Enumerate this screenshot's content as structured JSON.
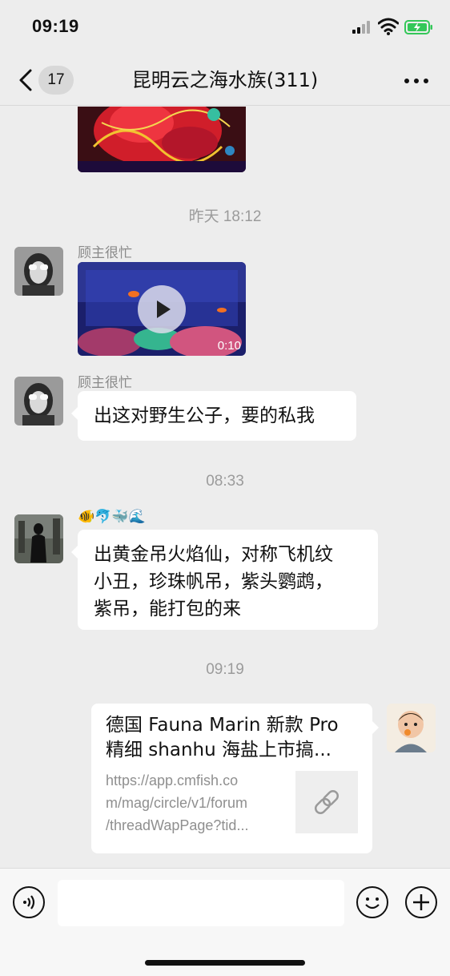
{
  "status_bar": {
    "time": "09:19"
  },
  "nav": {
    "unread_count": "17",
    "title": "昆明云之海水族(311)"
  },
  "messages": [
    {
      "type": "timestamp",
      "text": "昨天 18:12"
    },
    {
      "type": "video",
      "sender": "顾主很忙",
      "duration": "0:10"
    },
    {
      "type": "text",
      "sender": "顾主很忙",
      "text": "出这对野生公子，要的私我"
    },
    {
      "type": "timestamp",
      "text": "08:33"
    },
    {
      "type": "text",
      "sender_emoji": "🐠🐬🐳🌊",
      "lines": [
        "出黄金吊火焰仙，对称飞机纹",
        "小丑，珍珠帆吊，紫头鹦鹉，",
        "紫吊，能打包的来"
      ]
    },
    {
      "type": "timestamp",
      "text": "09:19"
    },
    {
      "type": "link",
      "title_lines": [
        "德国 Fauna Marin 新款 Pro",
        "精细 shanhu 海盐上市搞..."
      ],
      "url_lines": [
        "https://app.cmfish.co",
        "m/mag/circle/v1/forum",
        "/threadWapPage?tid..."
      ]
    }
  ],
  "icons": {
    "back": "chevron-left-icon",
    "more": "more-dots-icon",
    "voice": "voice-icon",
    "emoji": "emoji-icon",
    "plus": "plus-icon",
    "link": "link-icon",
    "play": "play-icon"
  },
  "colors": {
    "background": "#ededed",
    "bubble": "#ffffff",
    "timestamp": "#9b9b9b",
    "battery": "#34c759"
  }
}
